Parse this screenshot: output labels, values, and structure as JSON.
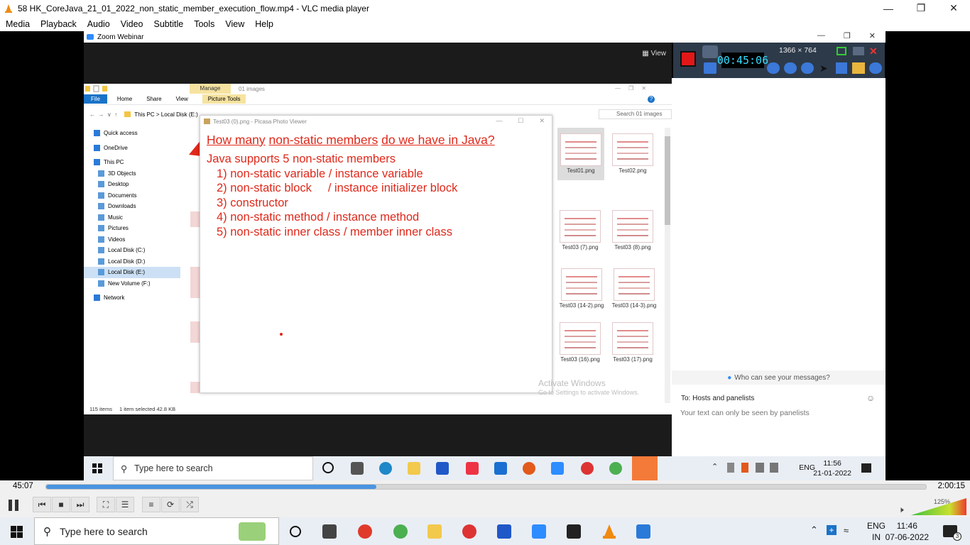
{
  "vlc": {
    "window_title": "58 HK_CoreJava_21_01_2022_non_static_member_execution_flow.mp4 - VLC media player",
    "menu": [
      "Media",
      "Playback",
      "Audio",
      "Video",
      "Subtitle",
      "Tools",
      "View",
      "Help"
    ],
    "time_elapsed": "45:07",
    "time_total": "2:00:15",
    "progress_fraction": 0.375,
    "volume_label": "125%",
    "volume_fraction": 1.0
  },
  "zoom": {
    "window_title": "Zoom Webinar",
    "view_label": "View"
  },
  "explorer": {
    "manage_tab": "Manage",
    "picture_tools": "Picture Tools",
    "folder_label": "01 images",
    "ribbon_tabs": [
      "File",
      "Home",
      "Share",
      "View"
    ],
    "address": "This PC  >  Local Disk (E:)",
    "search_placeholder": "Search 01 images",
    "nav": [
      {
        "label": "Quick access",
        "sub": false
      },
      {
        "label": "OneDrive",
        "sub": false
      },
      {
        "label": "This PC",
        "sub": false
      },
      {
        "label": "3D Objects",
        "sub": true
      },
      {
        "label": "Desktop",
        "sub": true
      },
      {
        "label": "Documents",
        "sub": true
      },
      {
        "label": "Downloads",
        "sub": true
      },
      {
        "label": "Music",
        "sub": true
      },
      {
        "label": "Pictures",
        "sub": true
      },
      {
        "label": "Videos",
        "sub": true
      },
      {
        "label": "Local Disk (C:)",
        "sub": true
      },
      {
        "label": "Local Disk (D:)",
        "sub": true
      },
      {
        "label": "Local Disk (E:)",
        "sub": true
      },
      {
        "label": "New Volume (F:)",
        "sub": true
      },
      {
        "label": "Network",
        "sub": false
      }
    ],
    "thumbnails": [
      "Test01.png",
      "Test02.png",
      "Test03 (7).png",
      "Test03 (8).png",
      "Test03 (14-2).png",
      "Test03 (14-3).png",
      "Test03 (16).png",
      "Test03 (17).png"
    ],
    "status_items": "115 items",
    "status_selected": "1 item selected  42.8 KB"
  },
  "picasa": {
    "title": "Test03 (0).png - Picasa Photo Viewer",
    "question_parts": [
      "How many",
      "non-static members",
      "do we have in Java?"
    ],
    "heading": "Java supports 5 non-static members",
    "items": [
      "1) non-static variable / instance variable",
      "2) non-static block     / instance initializer block",
      "3) constructor",
      "4) non-static method / instance method",
      "5) non-static inner class / member inner class"
    ]
  },
  "watermark": {
    "line1": "Activate Windows",
    "line2": "Go to Settings to activate Windows."
  },
  "recorder": {
    "time": "00:45:06",
    "resolution": "1366 × 764"
  },
  "chat": {
    "who_can_see": "Who can see your messages?",
    "to_label": "To:  Hosts and panelists",
    "input_placeholder": "Your text can only be seen by panelists"
  },
  "inner_taskbar": {
    "search": "Type here to search",
    "lang": "ENG",
    "time": "11:56",
    "date": "21-01-2022"
  },
  "taskbar": {
    "search": "Type here to search",
    "lang": "ENG",
    "region": "IN",
    "time": "11:46",
    "date": "07-06-2022",
    "notification_count": "3"
  }
}
